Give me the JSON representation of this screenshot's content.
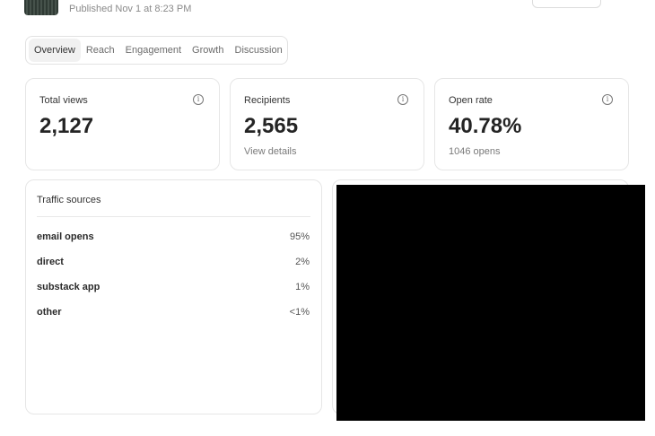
{
  "header": {
    "published": "Published Nov 1 at 8:23 PM"
  },
  "tabs": [
    {
      "label": "Overview"
    },
    {
      "label": "Reach"
    },
    {
      "label": "Engagement"
    },
    {
      "label": "Growth"
    },
    {
      "label": "Discussion"
    }
  ],
  "stats": {
    "total_views": {
      "label": "Total views",
      "value": "2,127"
    },
    "recipients": {
      "label": "Recipients",
      "value": "2,565",
      "sub": "View details"
    },
    "open_rate": {
      "label": "Open rate",
      "value": "40.78%",
      "sub": "1046 opens"
    }
  },
  "traffic": {
    "title": "Traffic sources",
    "rows": [
      {
        "name": "email opens",
        "pct": "95%"
      },
      {
        "name": "direct",
        "pct": "2%"
      },
      {
        "name": "substack app",
        "pct": "1%"
      },
      {
        "name": "other",
        "pct": "<1%"
      }
    ]
  },
  "icons": {
    "info": "info-icon"
  }
}
